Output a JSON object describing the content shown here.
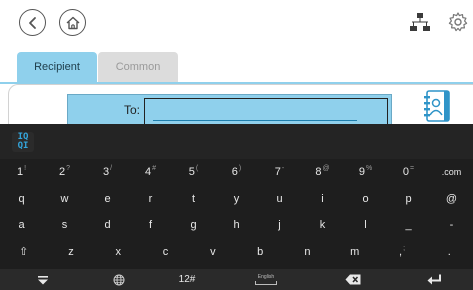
{
  "header": {
    "back_icon": "back-arrow-icon",
    "home_icon": "home-icon",
    "network_icon": "network-icon",
    "settings_icon": "gear-icon"
  },
  "tabs": [
    {
      "label": "Recipient",
      "selected": true
    },
    {
      "label": "Common",
      "selected": false
    }
  ],
  "form": {
    "to_label": "To:",
    "to_value": "",
    "address_book_icon": "address-book-icon"
  },
  "keyboard": {
    "logo": "IQQI",
    "rows": [
      [
        {
          "k": "1",
          "s": "!"
        },
        {
          "k": "2",
          "s": "?"
        },
        {
          "k": "3",
          "s": "/"
        },
        {
          "k": "4",
          "s": "#"
        },
        {
          "k": "5",
          "s": "("
        },
        {
          "k": "6",
          "s": ")"
        },
        {
          "k": "7",
          "s": "-"
        },
        {
          "k": "8",
          "s": "@"
        },
        {
          "k": "9",
          "s": "%"
        },
        {
          "k": "0",
          "s": "="
        },
        {
          "k": ".com",
          "s": ""
        }
      ],
      [
        {
          "k": "q",
          "s": ""
        },
        {
          "k": "w",
          "s": ""
        },
        {
          "k": "e",
          "s": ""
        },
        {
          "k": "r",
          "s": ""
        },
        {
          "k": "t",
          "s": ""
        },
        {
          "k": "y",
          "s": ""
        },
        {
          "k": "u",
          "s": ""
        },
        {
          "k": "i",
          "s": ""
        },
        {
          "k": "o",
          "s": ""
        },
        {
          "k": "p",
          "s": ""
        },
        {
          "k": "@",
          "s": ""
        }
      ],
      [
        {
          "k": "a",
          "s": ""
        },
        {
          "k": "s",
          "s": ""
        },
        {
          "k": "d",
          "s": ""
        },
        {
          "k": "f",
          "s": ""
        },
        {
          "k": "g",
          "s": ""
        },
        {
          "k": "h",
          "s": ""
        },
        {
          "k": "j",
          "s": ""
        },
        {
          "k": "k",
          "s": ""
        },
        {
          "k": "l",
          "s": ""
        },
        {
          "k": "_",
          "s": ""
        },
        {
          "k": "-",
          "s": ""
        }
      ],
      [
        {
          "k": "⇧",
          "s": ""
        },
        {
          "k": "z",
          "s": ""
        },
        {
          "k": "x",
          "s": ""
        },
        {
          "k": "c",
          "s": ""
        },
        {
          "k": "v",
          "s": ""
        },
        {
          "k": "b",
          "s": ""
        },
        {
          "k": "n",
          "s": ""
        },
        {
          "k": "m",
          "s": ""
        },
        {
          "k": ",",
          "s": ";"
        },
        {
          "k": ".",
          "s": ""
        }
      ]
    ],
    "bottom": {
      "hide_icon": "hide-keyboard-icon",
      "globe_icon": "globe-icon",
      "numeric_label": "12#",
      "space_label": "English",
      "backspace_icon": "backspace-icon",
      "enter_icon": "enter-icon"
    }
  }
}
